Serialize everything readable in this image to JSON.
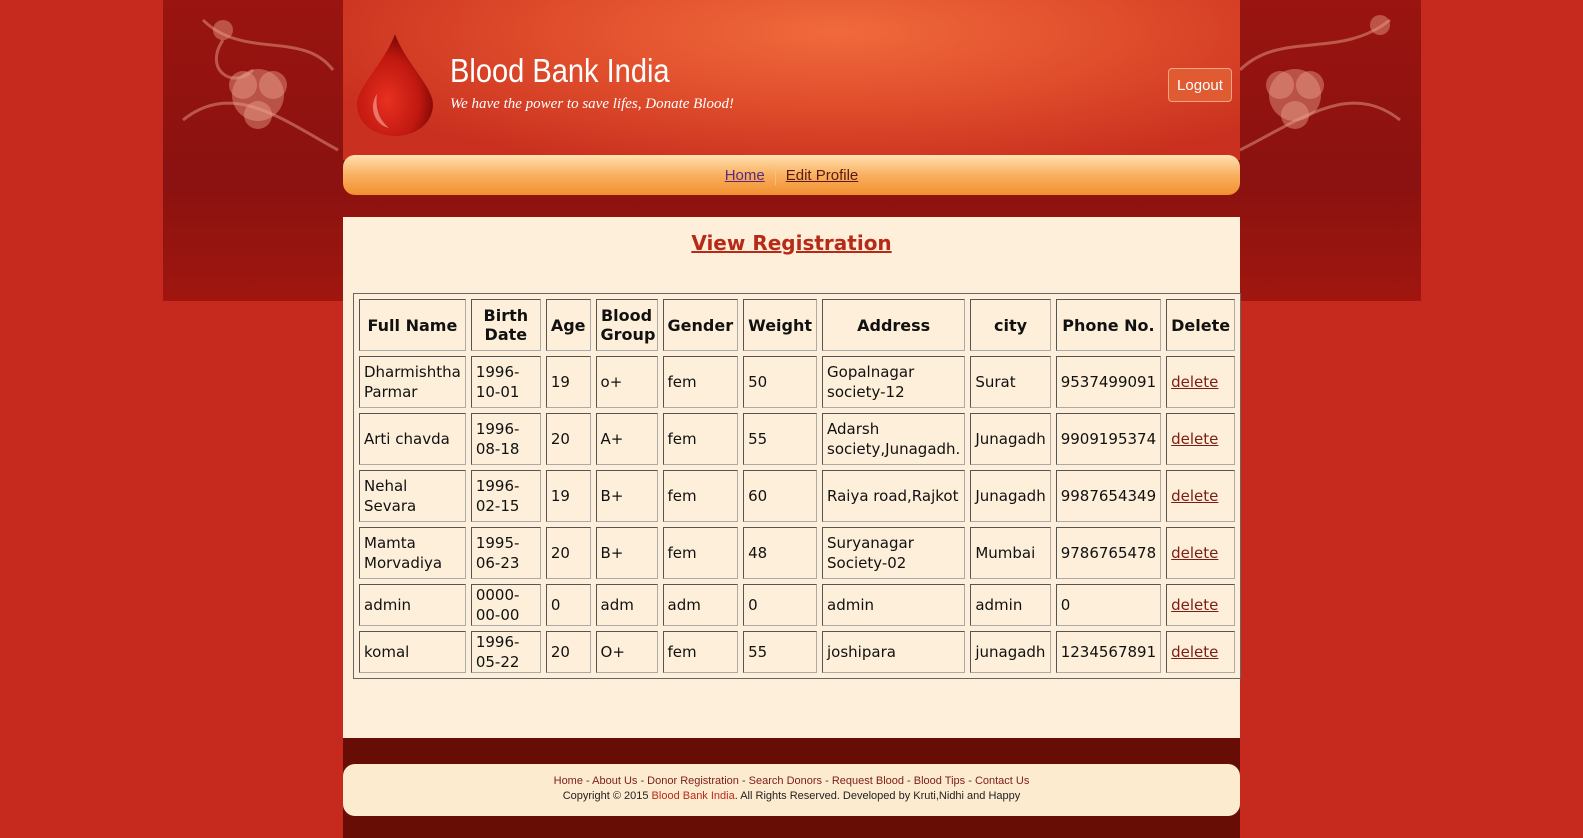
{
  "header": {
    "site_title": "Blood Bank India",
    "tagline": "We have the power to save lifes, Donate Blood!",
    "logout_label": "Logout"
  },
  "nav": {
    "home_label": "Home",
    "edit_profile_label": "Edit Profile"
  },
  "main": {
    "title": "View Registration",
    "table": {
      "headers": [
        "Full Name",
        "Birth Date",
        "Age",
        "Blood Group",
        "Gender",
        "Weight",
        "Address",
        "city",
        "Phone No.",
        "Delete"
      ],
      "rows": [
        {
          "full_name": "Dharmishtha Parmar",
          "birth_date": "1996-10-01",
          "age": "19",
          "blood_group": "o+",
          "gender": "fem",
          "weight": "50",
          "address": "Gopalnagar society-12",
          "city": "Surat",
          "phone": "9537499091",
          "delete": "delete"
        },
        {
          "full_name": "Arti chavda",
          "birth_date": "1996-08-18",
          "age": "20",
          "blood_group": "A+",
          "gender": "fem",
          "weight": "55",
          "address": "Adarsh society,Junagadh.",
          "city": "Junagadh",
          "phone": "9909195374",
          "delete": "delete"
        },
        {
          "full_name": "Nehal Sevara",
          "birth_date": "1996-02-15",
          "age": "19",
          "blood_group": "B+",
          "gender": "fem",
          "weight": "60",
          "address": "Raiya road,Rajkot",
          "city": "Junagadh",
          "phone": "9987654349",
          "delete": "delete"
        },
        {
          "full_name": "Mamta Morvadiya",
          "birth_date": "1995-06-23",
          "age": "20",
          "blood_group": "B+",
          "gender": "fem",
          "weight": "48",
          "address": "Suryanagar Society-02",
          "city": "Mumbai",
          "phone": "9786765478",
          "delete": "delete"
        },
        {
          "full_name": "admin",
          "birth_date": "0000-00-00",
          "age": "0",
          "blood_group": "adm",
          "gender": "adm",
          "weight": "0",
          "address": "admin",
          "city": "admin",
          "phone": "0",
          "delete": "delete"
        },
        {
          "full_name": "komal",
          "birth_date": "1996-05-22",
          "age": "20",
          "blood_group": "O+",
          "gender": "fem",
          "weight": "55",
          "address": "joshipara",
          "city": "junagadh",
          "phone": "1234567891",
          "delete": "delete"
        }
      ]
    }
  },
  "footer": {
    "links": [
      "Home",
      "About Us",
      "Donor Registration",
      "Search Donors",
      "Request Blood",
      "Blood Tips",
      "Contact Us"
    ],
    "separator": " - ",
    "copyright_prefix": "Copyright © 2015 ",
    "copyright_brand": "Blood Bank India",
    "copyright_suffix": ". All Rights Reserved. Developed by Kruti,Nidhi and Happy"
  },
  "icons": {
    "logo": "blood-drop-icon"
  },
  "colors": {
    "background": "#c62a1e",
    "accent": "#b82a18",
    "content_bg": "#fdefd9",
    "footer_dark": "#680d06",
    "nav_orange": "#f29030"
  }
}
